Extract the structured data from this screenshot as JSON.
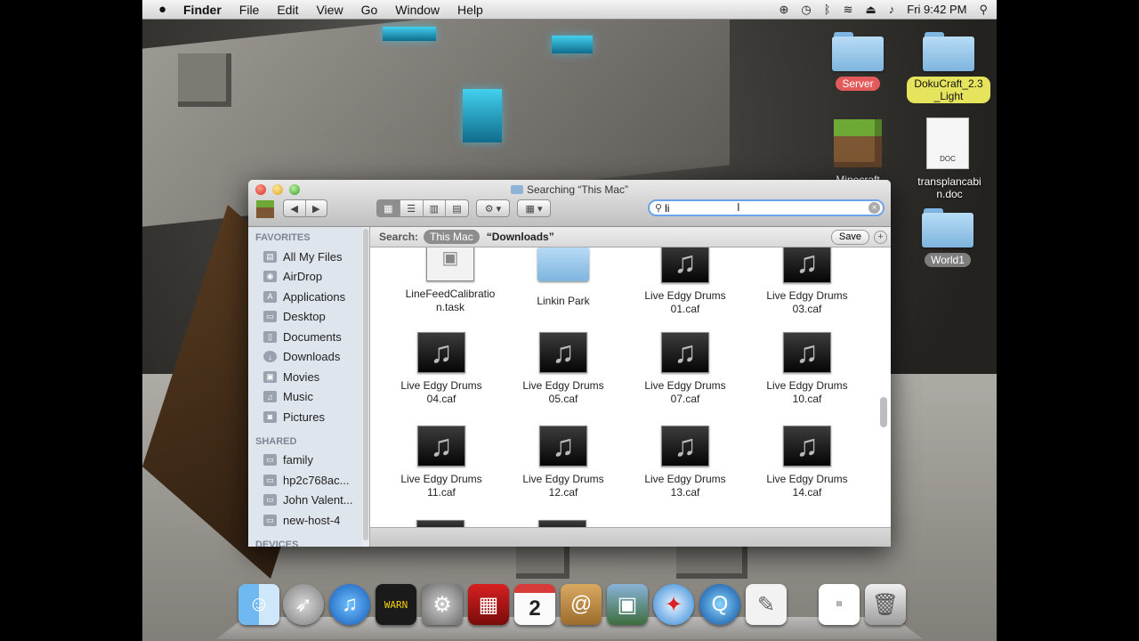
{
  "menubar": {
    "apple": "",
    "app_name": "Finder",
    "items": [
      "File",
      "Edit",
      "View",
      "Go",
      "Window",
      "Help"
    ],
    "clock": "Fri 9:42 PM"
  },
  "desktop": {
    "icons": [
      {
        "label": "Server",
        "tag": "red"
      },
      {
        "label": "DokuCraft_2.3 _Light",
        "tag": "yellow"
      },
      {
        "label": "Minecraft",
        "tag": "none"
      },
      {
        "label": "transplancabi n.doc",
        "tag": "none",
        "type_label": "DOC"
      },
      {
        "label": "World1",
        "tag": "gray"
      }
    ]
  },
  "window": {
    "title": "Searching “This Mac”",
    "search_value": "li",
    "search_label": "Search:",
    "scope_this_mac": "This Mac",
    "scope_downloads": "“Downloads”",
    "save_label": "Save",
    "sidebar": {
      "favorites_header": "FAVORITES",
      "favorites": [
        "All My Files",
        "AirDrop",
        "Applications",
        "Desktop",
        "Documents",
        "Downloads",
        "Movies",
        "Music",
        "Pictures"
      ],
      "shared_header": "SHARED",
      "shared": [
        "family",
        "hp2c768ac...",
        "John Valent...",
        "new-host-4"
      ],
      "devices_header": "DEVICES"
    },
    "files": [
      {
        "line1": "LineFeedCalibratio",
        "line2": "n.task",
        "kind": "task"
      },
      {
        "line1": "Linkin Park",
        "line2": "",
        "kind": "folder"
      },
      {
        "line1": "Live Edgy Drums",
        "line2": "01.caf",
        "kind": "audio"
      },
      {
        "line1": "Live Edgy Drums",
        "line2": "03.caf",
        "kind": "audio"
      },
      {
        "line1": "Live Edgy Drums",
        "line2": "04.caf",
        "kind": "audio"
      },
      {
        "line1": "Live Edgy Drums",
        "line2": "05.caf",
        "kind": "audio"
      },
      {
        "line1": "Live Edgy Drums",
        "line2": "07.caf",
        "kind": "audio"
      },
      {
        "line1": "Live Edgy Drums",
        "line2": "10.caf",
        "kind": "audio"
      },
      {
        "line1": "Live Edgy Drums",
        "line2": "11.caf",
        "kind": "audio"
      },
      {
        "line1": "Live Edgy Drums",
        "line2": "12.caf",
        "kind": "audio"
      },
      {
        "line1": "Live Edgy Drums",
        "line2": "13.caf",
        "kind": "audio"
      },
      {
        "line1": "Live Edgy Drums",
        "line2": "14.caf",
        "kind": "audio"
      }
    ]
  },
  "dock": {
    "apps": [
      "finder-icon",
      "launchpad-icon",
      "itunes-icon",
      "console-icon",
      "system-preferences-icon",
      "photo-booth-icon",
      "ical-icon",
      "address-book-icon",
      "iphoto-icon",
      "safari-icon",
      "quicktime-icon",
      "textedit-icon",
      "downloads-stack-icon",
      "trash-icon"
    ],
    "ical_date": "2"
  }
}
